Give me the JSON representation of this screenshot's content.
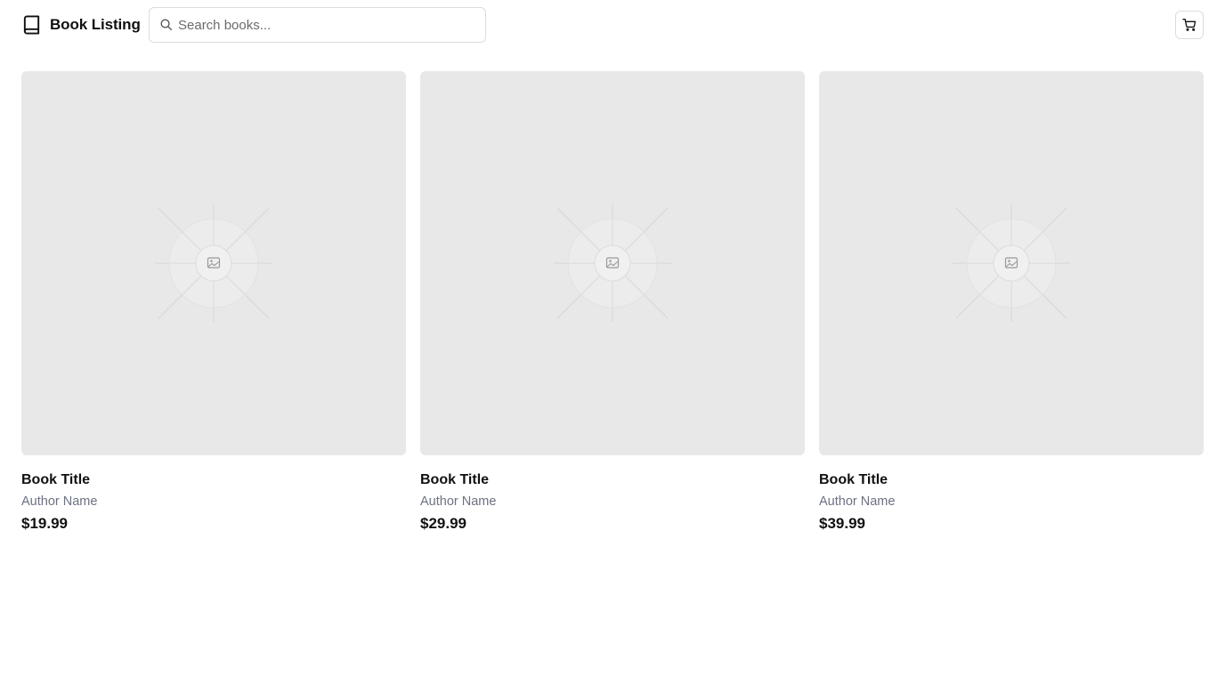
{
  "header": {
    "brand_icon": "book-icon",
    "title": "Book Listing",
    "search": {
      "placeholder": "Search books...",
      "value": "",
      "icon": "search-icon"
    },
    "cart": {
      "icon": "shopping-cart-icon"
    }
  },
  "books": [
    {
      "title": "Book Title",
      "author": "Author Name",
      "price": "$19.99",
      "cover_icon": "image-placeholder-icon"
    },
    {
      "title": "Book Title",
      "author": "Author Name",
      "price": "$29.99",
      "cover_icon": "image-placeholder-icon"
    },
    {
      "title": "Book Title",
      "author": "Author Name",
      "price": "$39.99",
      "cover_icon": "image-placeholder-icon"
    }
  ],
  "colors": {
    "cover_background": "#e8e8e8",
    "muted_text": "#6b7280",
    "border": "#dcdcdc"
  }
}
